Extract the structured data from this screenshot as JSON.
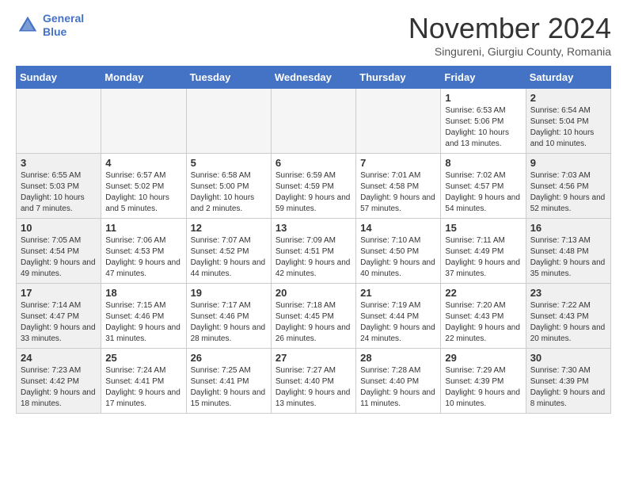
{
  "header": {
    "logo_line1": "General",
    "logo_line2": "Blue",
    "month": "November 2024",
    "location": "Singureni, Giurgiu County, Romania"
  },
  "weekdays": [
    "Sunday",
    "Monday",
    "Tuesday",
    "Wednesday",
    "Thursday",
    "Friday",
    "Saturday"
  ],
  "weeks": [
    [
      {
        "day": "",
        "info": ""
      },
      {
        "day": "",
        "info": ""
      },
      {
        "day": "",
        "info": ""
      },
      {
        "day": "",
        "info": ""
      },
      {
        "day": "",
        "info": ""
      },
      {
        "day": "1",
        "info": "Sunrise: 6:53 AM\nSunset: 5:06 PM\nDaylight: 10 hours and 13 minutes."
      },
      {
        "day": "2",
        "info": "Sunrise: 6:54 AM\nSunset: 5:04 PM\nDaylight: 10 hours and 10 minutes."
      }
    ],
    [
      {
        "day": "3",
        "info": "Sunrise: 6:55 AM\nSunset: 5:03 PM\nDaylight: 10 hours and 7 minutes."
      },
      {
        "day": "4",
        "info": "Sunrise: 6:57 AM\nSunset: 5:02 PM\nDaylight: 10 hours and 5 minutes."
      },
      {
        "day": "5",
        "info": "Sunrise: 6:58 AM\nSunset: 5:00 PM\nDaylight: 10 hours and 2 minutes."
      },
      {
        "day": "6",
        "info": "Sunrise: 6:59 AM\nSunset: 4:59 PM\nDaylight: 9 hours and 59 minutes."
      },
      {
        "day": "7",
        "info": "Sunrise: 7:01 AM\nSunset: 4:58 PM\nDaylight: 9 hours and 57 minutes."
      },
      {
        "day": "8",
        "info": "Sunrise: 7:02 AM\nSunset: 4:57 PM\nDaylight: 9 hours and 54 minutes."
      },
      {
        "day": "9",
        "info": "Sunrise: 7:03 AM\nSunset: 4:56 PM\nDaylight: 9 hours and 52 minutes."
      }
    ],
    [
      {
        "day": "10",
        "info": "Sunrise: 7:05 AM\nSunset: 4:54 PM\nDaylight: 9 hours and 49 minutes."
      },
      {
        "day": "11",
        "info": "Sunrise: 7:06 AM\nSunset: 4:53 PM\nDaylight: 9 hours and 47 minutes."
      },
      {
        "day": "12",
        "info": "Sunrise: 7:07 AM\nSunset: 4:52 PM\nDaylight: 9 hours and 44 minutes."
      },
      {
        "day": "13",
        "info": "Sunrise: 7:09 AM\nSunset: 4:51 PM\nDaylight: 9 hours and 42 minutes."
      },
      {
        "day": "14",
        "info": "Sunrise: 7:10 AM\nSunset: 4:50 PM\nDaylight: 9 hours and 40 minutes."
      },
      {
        "day": "15",
        "info": "Sunrise: 7:11 AM\nSunset: 4:49 PM\nDaylight: 9 hours and 37 minutes."
      },
      {
        "day": "16",
        "info": "Sunrise: 7:13 AM\nSunset: 4:48 PM\nDaylight: 9 hours and 35 minutes."
      }
    ],
    [
      {
        "day": "17",
        "info": "Sunrise: 7:14 AM\nSunset: 4:47 PM\nDaylight: 9 hours and 33 minutes."
      },
      {
        "day": "18",
        "info": "Sunrise: 7:15 AM\nSunset: 4:46 PM\nDaylight: 9 hours and 31 minutes."
      },
      {
        "day": "19",
        "info": "Sunrise: 7:17 AM\nSunset: 4:46 PM\nDaylight: 9 hours and 28 minutes."
      },
      {
        "day": "20",
        "info": "Sunrise: 7:18 AM\nSunset: 4:45 PM\nDaylight: 9 hours and 26 minutes."
      },
      {
        "day": "21",
        "info": "Sunrise: 7:19 AM\nSunset: 4:44 PM\nDaylight: 9 hours and 24 minutes."
      },
      {
        "day": "22",
        "info": "Sunrise: 7:20 AM\nSunset: 4:43 PM\nDaylight: 9 hours and 22 minutes."
      },
      {
        "day": "23",
        "info": "Sunrise: 7:22 AM\nSunset: 4:43 PM\nDaylight: 9 hours and 20 minutes."
      }
    ],
    [
      {
        "day": "24",
        "info": "Sunrise: 7:23 AM\nSunset: 4:42 PM\nDaylight: 9 hours and 18 minutes."
      },
      {
        "day": "25",
        "info": "Sunrise: 7:24 AM\nSunset: 4:41 PM\nDaylight: 9 hours and 17 minutes."
      },
      {
        "day": "26",
        "info": "Sunrise: 7:25 AM\nSunset: 4:41 PM\nDaylight: 9 hours and 15 minutes."
      },
      {
        "day": "27",
        "info": "Sunrise: 7:27 AM\nSunset: 4:40 PM\nDaylight: 9 hours and 13 minutes."
      },
      {
        "day": "28",
        "info": "Sunrise: 7:28 AM\nSunset: 4:40 PM\nDaylight: 9 hours and 11 minutes."
      },
      {
        "day": "29",
        "info": "Sunrise: 7:29 AM\nSunset: 4:39 PM\nDaylight: 9 hours and 10 minutes."
      },
      {
        "day": "30",
        "info": "Sunrise: 7:30 AM\nSunset: 4:39 PM\nDaylight: 9 hours and 8 minutes."
      }
    ]
  ]
}
